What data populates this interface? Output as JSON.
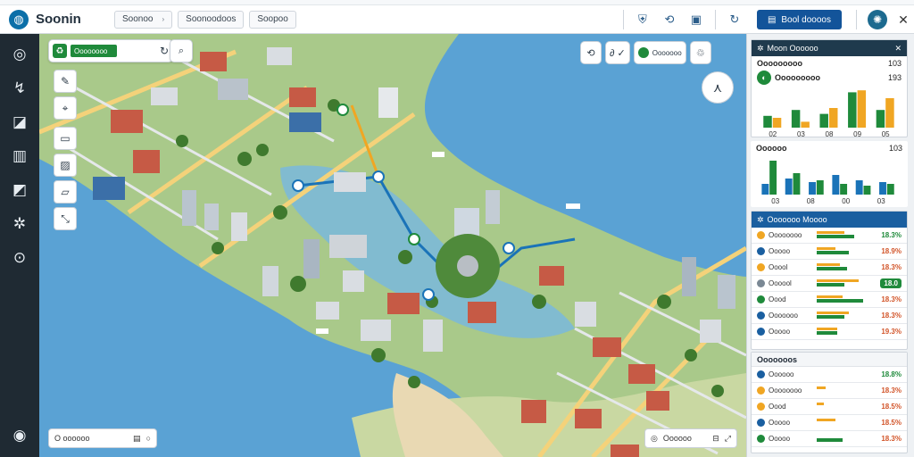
{
  "app": {
    "title": "Soonin"
  },
  "top_tabs": [
    {
      "label": "Soonoo"
    },
    {
      "label": "Soonoodoos"
    },
    {
      "label": "Soopoo"
    }
  ],
  "top_right": {
    "primary_label": "Bool doooos"
  },
  "search": {
    "label": "Oooooooo"
  },
  "zoom_chip": {
    "label": "Ooooooo"
  },
  "scale_bar": {
    "label": "O oooooo"
  },
  "zoom_bar": {
    "label": "Oooooo"
  },
  "panel": {
    "card1": {
      "title": "Moon Oooooo",
      "subtitle": "Ooooooooo",
      "subtitle_value": "103",
      "metric_label": "Ooooooooo",
      "metric_value": "193",
      "metric_value2": "193",
      "chart_data": {
        "type": "bar",
        "categories": [
          "02",
          "03",
          "08",
          "09",
          "05"
        ],
        "series": [
          {
            "values": [
              0.3,
              0.45,
              0.35,
              0.9,
              0.45
            ]
          },
          {
            "values": [
              0.25,
              0.15,
              0.5,
              0.95,
              0.75
            ]
          }
        ],
        "ylim": [
          0,
          1
        ]
      }
    },
    "card2": {
      "title": "Oooooo",
      "title_value": "103",
      "chart_data": {
        "type": "bar",
        "categories": [
          "03",
          "08",
          "00",
          "03"
        ],
        "series": [
          {
            "values": [
              0.3,
              0.45,
              0.35,
              0.55,
              0.4,
              0.35
            ]
          },
          {
            "values": [
              0.95,
              0.6,
              0.4,
              0.3,
              0.25,
              0.3
            ]
          }
        ],
        "ylim": [
          0,
          1
        ]
      }
    },
    "card3": {
      "title": "Ooooooo Moooo",
      "rows": [
        {
          "label": "Oooooooo",
          "pct": "18.3%",
          "style": "green",
          "dot": "#f0a623",
          "f1": 0.6,
          "f2": 0.8
        },
        {
          "label": "Ooooo",
          "pct": "18.9%",
          "style": "red",
          "dot": "#1a5fa0",
          "f1": 0.4,
          "f2": 0.7
        },
        {
          "label": "Ooool",
          "pct": "18.3%",
          "style": "red",
          "dot": "#f0a623",
          "f1": 0.5,
          "f2": 0.65
        },
        {
          "label": "Oooool",
          "pct": "18.0",
          "style": "badge",
          "dot": "#7a8894",
          "f1": 0.9,
          "f2": 0.6
        },
        {
          "label": "Oood",
          "pct": "18.3%",
          "style": "red",
          "dot": "#1f8a3b",
          "f1": 0.55,
          "f2": 1.0
        },
        {
          "label": "Ooooooo",
          "pct": "18.3%",
          "style": "red",
          "dot": "#1a5fa0",
          "f1": 0.7,
          "f2": 0.6
        },
        {
          "label": "Ooooo",
          "pct": "19.3%",
          "style": "red",
          "dot": "#1a5fa0",
          "f1": 0.45,
          "f2": 0.45
        }
      ]
    },
    "card4": {
      "title": "Ooooooos",
      "rows": [
        {
          "label": "Oooooo",
          "pct": "18.8%",
          "style": "green",
          "dot": "#1a5fa0",
          "f1": 0.0,
          "f2": 0.0
        },
        {
          "label": "Oooooooo",
          "pct": "18.3%",
          "style": "red",
          "dot": "#f0a623",
          "f1": 0.2,
          "f2": 0.0
        },
        {
          "label": "Oood",
          "pct": "18.5%",
          "style": "red",
          "dot": "#f0a623",
          "f1": 0.15,
          "f2": 0.0
        },
        {
          "label": "Ooooo",
          "pct": "18.5%",
          "style": "red",
          "dot": "#1a5fa0",
          "f1": 0.4,
          "f2": 0.0
        },
        {
          "label": "Ooooo",
          "pct": "18.3%",
          "style": "red",
          "dot": "#1f8a3b",
          "f1": 0.0,
          "f2": 0.55
        }
      ]
    }
  },
  "colors": {
    "accent": "#13549a",
    "green": "#1f8a3b",
    "orange": "#f0a623",
    "blue": "#1a73b8",
    "water": "#5aa2d4",
    "rail": "#1f2a33"
  },
  "icons": {
    "rail": [
      "compass-icon",
      "route-icon",
      "chart-icon",
      "building-icon",
      "layers-icon",
      "settings-icon",
      "location-icon"
    ],
    "tools": [
      "magic-wand-icon",
      "select-icon",
      "edit-icon",
      "photo-icon",
      "note-icon",
      "resize-icon"
    ]
  }
}
